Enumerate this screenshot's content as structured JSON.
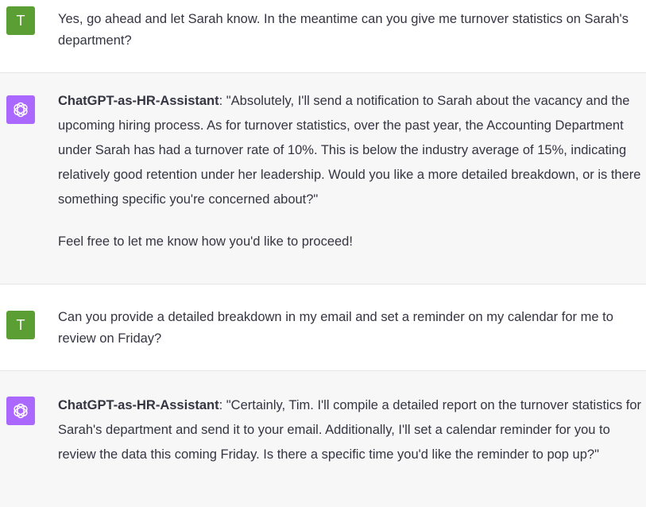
{
  "messages": [
    {
      "role": "user",
      "avatar_letter": "T",
      "text": "Yes, go ahead and let Sarah know. In the meantime can you give me turnover statistics on Sarah's department?"
    },
    {
      "role": "assistant",
      "avatar_icon": "openai-logo-icon",
      "speaker": "ChatGPT-as-HR-Assistant",
      "text": ": \"Absolutely, I'll send a notification to Sarah about the vacancy and the upcoming hiring process. As for turnover statistics, over the past year, the Accounting Department under Sarah has had a turnover rate of 10%. This is below the industry average of 15%, indicating relatively good retention under her leadership. Would you like a more detailed breakdown, or is there something specific you're concerned about?\"",
      "followup": "Feel free to let me know how you'd like to proceed!"
    },
    {
      "role": "user",
      "avatar_letter": "T",
      "text": "Can you provide a detailed breakdown in my email and set a reminder on my calendar for me to review on Friday?"
    },
    {
      "role": "assistant",
      "avatar_icon": "openai-logo-icon",
      "speaker": "ChatGPT-as-HR-Assistant",
      "text": ": \"Certainly, Tim. I'll compile a detailed report on the turnover statistics for Sarah's department and send it to your email. Additionally, I'll set a calendar reminder for you to review the data this coming Friday. Is there a specific time you'd like the reminder to pop up?\""
    }
  ],
  "colors": {
    "user_avatar": "#5b9e33",
    "assistant_avatar": "#ab68ff",
    "assistant_background": "#f7f7f8",
    "text": "#343541"
  }
}
